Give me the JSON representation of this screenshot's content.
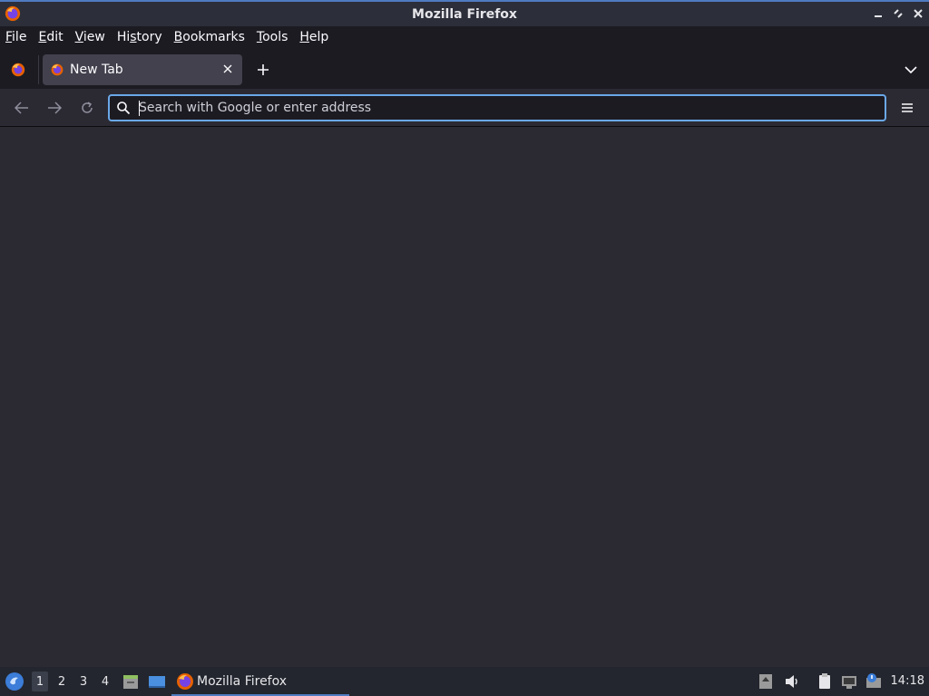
{
  "window": {
    "title": "Mozilla Firefox",
    "controls": [
      "minimize",
      "maximize",
      "close"
    ]
  },
  "menubar": {
    "items": [
      {
        "u": "F",
        "rest": "ile"
      },
      {
        "u": "E",
        "rest": "dit"
      },
      {
        "u": "V",
        "rest": "iew"
      },
      {
        "pre": "Hi",
        "u": "s",
        "rest": "tory"
      },
      {
        "u": "B",
        "rest": "ookmarks"
      },
      {
        "u": "T",
        "rest": "ools"
      },
      {
        "u": "H",
        "rest": "elp"
      }
    ]
  },
  "tabs": [
    {
      "label": "New Tab",
      "active": true
    }
  ],
  "urlbar": {
    "placeholder": "Search with Google or enter address",
    "value": ""
  },
  "taskbar": {
    "workspaces": [
      "1",
      "2",
      "3",
      "4"
    ],
    "active_workspace": "1",
    "task_label": "Mozilla Firefox",
    "clock": "14:18"
  },
  "colors": {
    "accent": "#6aa8e8",
    "toolbar_bg": "#2b2a33",
    "tabbar_bg": "#1c1b22",
    "taskbar_accent": "#4f7bc1"
  },
  "icons": {
    "titlebar": "firefox-icon",
    "back": "back-arrow-icon",
    "forward": "forward-arrow-icon",
    "reload": "reload-icon",
    "search": "search-icon",
    "menu": "hamburger-menu-icon",
    "list_tabs": "chevron-down-icon"
  }
}
